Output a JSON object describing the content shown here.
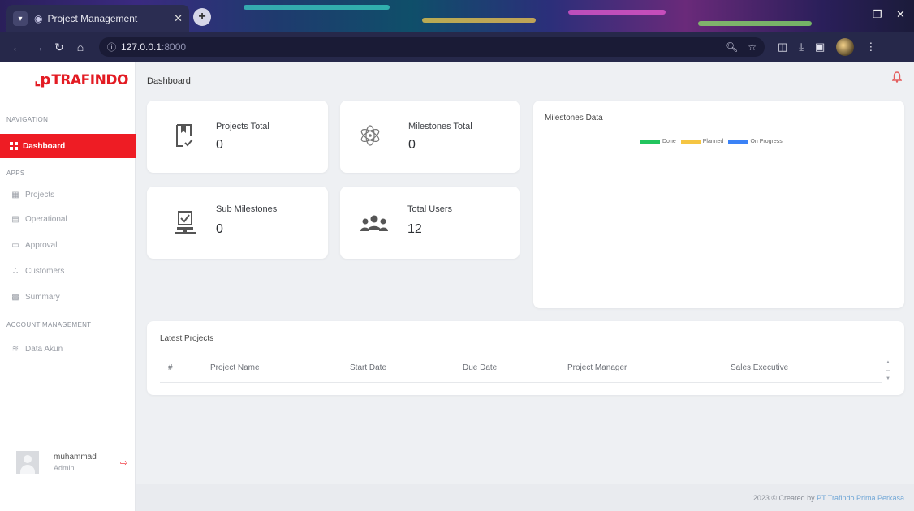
{
  "browser": {
    "tab_title": "Project Management",
    "url_host": "127.0.0.1",
    "url_port": ":8000"
  },
  "sidebar": {
    "logo_text": "TRAFINDO",
    "sections": {
      "navigation": "NAVIGATION",
      "apps": "APPS",
      "account_management": "ACCOUNT MANAGEMENT"
    },
    "active_item": {
      "label": "Dashboard",
      "icon": "grid-icon"
    },
    "apps_items": [
      {
        "label": "Projects",
        "icon": "projects-icon"
      },
      {
        "label": "Operational",
        "icon": "operational-icon"
      },
      {
        "label": "Approval",
        "icon": "approval-icon"
      },
      {
        "label": "Customers",
        "icon": "customers-icon"
      },
      {
        "label": "Summary",
        "icon": "summary-icon"
      }
    ],
    "account_items": [
      {
        "label": "Data Akun",
        "icon": "accounts-icon"
      }
    ],
    "user": {
      "name": "muhammad",
      "role": "Admin"
    }
  },
  "main": {
    "page_title": "Dashboard",
    "stats": [
      {
        "title": "Projects Total",
        "value": "0",
        "icon": "bookmark-check-icon"
      },
      {
        "title": "Milestones Total",
        "value": "0",
        "icon": "atom-icon"
      },
      {
        "title": "Sub Milestones",
        "value": "0",
        "icon": "monitor-check-icon"
      },
      {
        "title": "Total Users",
        "value": "12",
        "icon": "users-icon"
      }
    ],
    "milestones_chart": {
      "title": "Milestones Data",
      "legend": [
        {
          "label": "Done",
          "color": "#22c55e"
        },
        {
          "label": "Planned",
          "color": "#f5c542"
        },
        {
          "label": "On Progress",
          "color": "#3b82f6"
        }
      ]
    },
    "latest_projects": {
      "title": "Latest Projects",
      "columns": [
        "#",
        "Project Name",
        "Start Date",
        "Due Date",
        "Project Manager",
        "Sales Executive"
      ]
    }
  },
  "footer": {
    "prefix": "2023 © Created by",
    "company": "PT Trafindo Prima Perkasa"
  },
  "colors": {
    "accent": "#ee1c24",
    "background": "#eef0f3"
  }
}
